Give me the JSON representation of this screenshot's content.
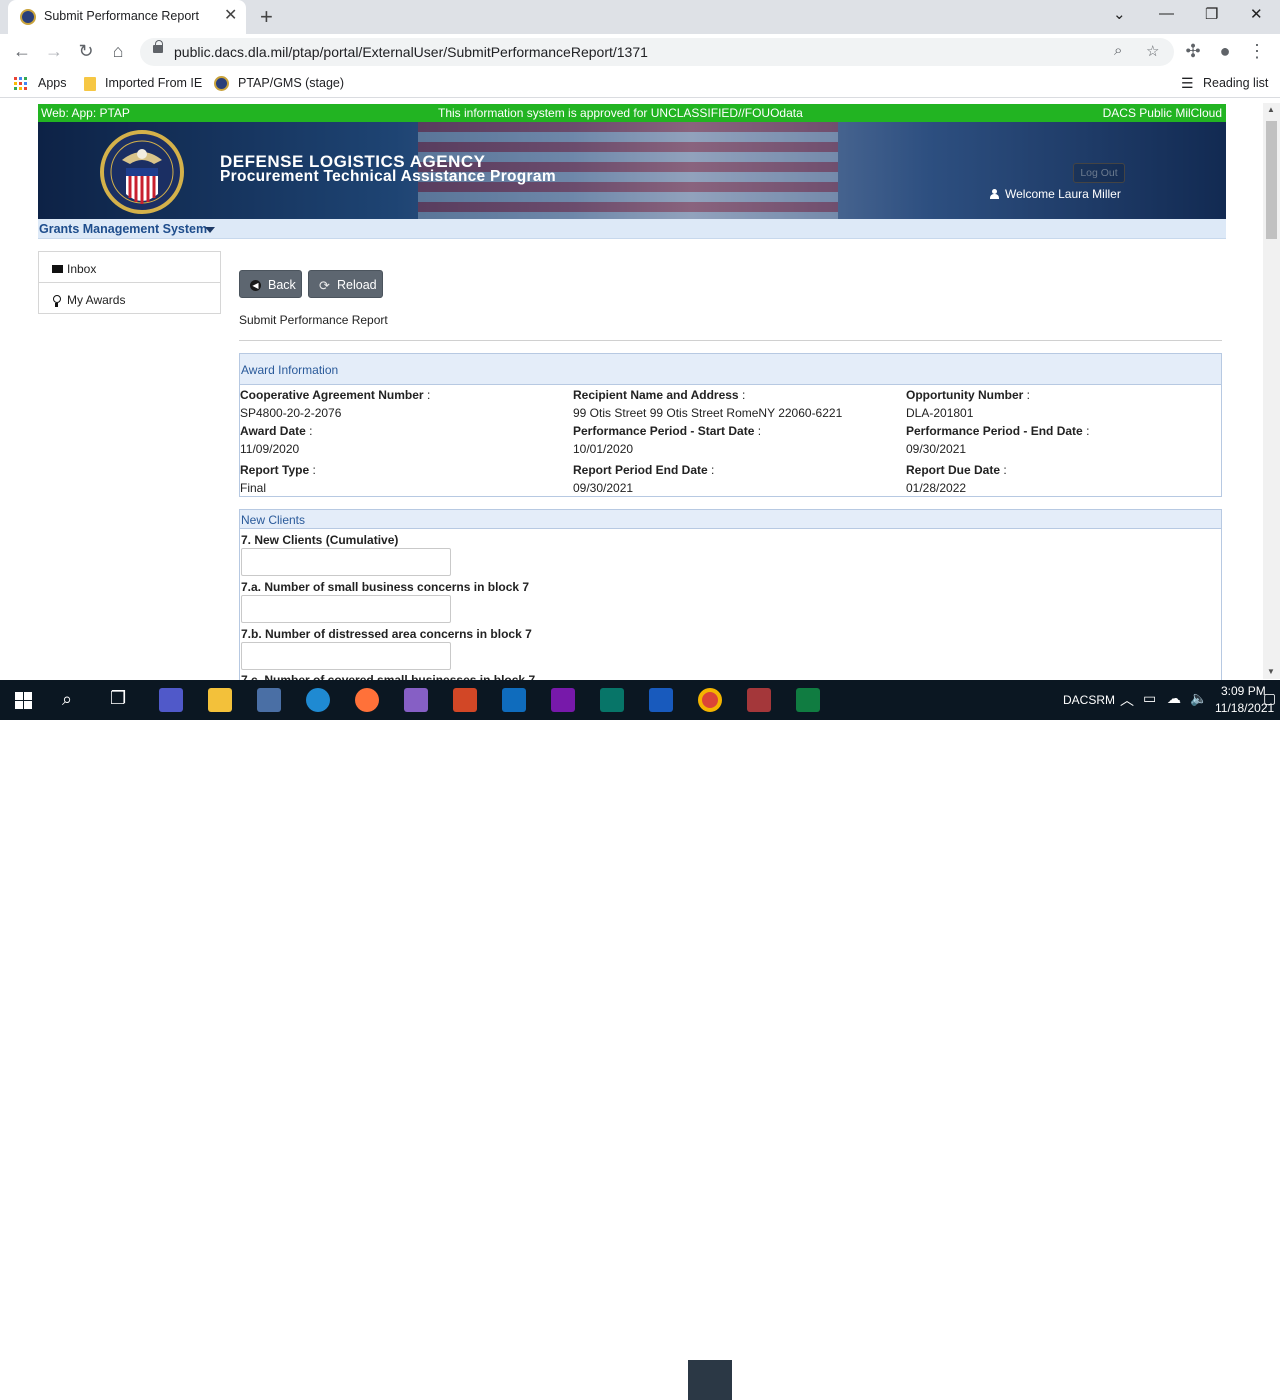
{
  "browser": {
    "tab_title": "Submit Performance Report",
    "url": "public.dacs.dla.mil/ptap/portal/ExternalUser/SubmitPerformanceReport/1371",
    "bookmarks": [
      "Apps",
      "Imported From IE",
      "PTAP/GMS (stage)"
    ],
    "reading_list": "Reading list"
  },
  "security_bar": {
    "left": "Web: App: PTAP",
    "center": "This information system is approved for UNCLASSIFIED//FOUOdata",
    "right": "DACS Public MilCloud"
  },
  "banner": {
    "line1": "DEFENSE LOGISTICS AGENCY",
    "line2": "Procurement Technical Assistance Program",
    "logout": "Log Out",
    "welcome": "Welcome Laura Miller"
  },
  "menu": {
    "title": "Grants Management System"
  },
  "sidenav": {
    "items": [
      "Inbox",
      "My Awards"
    ]
  },
  "actions": {
    "back": "Back",
    "reload": "Reload"
  },
  "page": {
    "heading": "Submit Performance Report"
  },
  "award_info": {
    "title": "Award Information",
    "fields": [
      {
        "label": "Cooperative Agreement Number",
        "value": "SP4800-20-2-2076"
      },
      {
        "label": "Recipient Name and Address",
        "value": "99 Otis Street 99 Otis Street RomeNY 22060-6221"
      },
      {
        "label": "Opportunity Number",
        "value": "DLA-201801"
      },
      {
        "label": "Award Date",
        "value": "11/09/2020"
      },
      {
        "label": "Performance Period - Start Date",
        "value": "10/01/2020"
      },
      {
        "label": "Performance Period - End Date",
        "value": "09/30/2021"
      },
      {
        "label": "Report Type",
        "value": "Final"
      },
      {
        "label": "Report Period End Date",
        "value": "09/30/2021"
      },
      {
        "label": "Report Due Date",
        "value": "01/28/2022"
      }
    ]
  },
  "new_clients": {
    "title": "New Clients",
    "questions": [
      {
        "label": "7. New Clients (Cumulative)",
        "value": ""
      },
      {
        "label": "7.a. Number of small business concerns in block 7",
        "value": ""
      },
      {
        "label": "7.b. Number of distressed area concerns in block 7",
        "value": ""
      },
      {
        "label": "7.c. Number of covered small businesses in block 7",
        "value": ""
      }
    ]
  },
  "taskbar": {
    "tray_label": "DACSRM",
    "time": "3:09 PM",
    "date": "11/18/2021"
  }
}
